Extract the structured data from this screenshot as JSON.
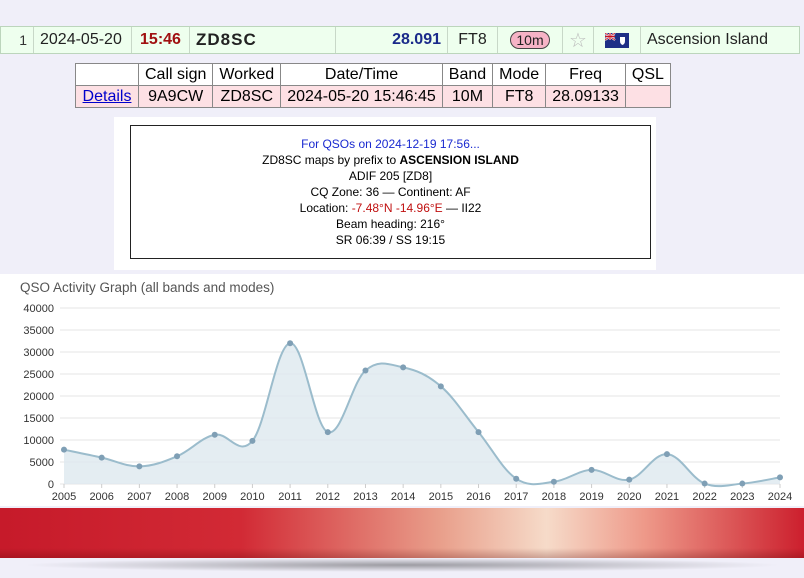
{
  "row": {
    "index": "1",
    "date": "2024-05-20",
    "time": "15:46",
    "callsign": "ZD8SC",
    "freq": "28.091",
    "mode": "FT8",
    "band": "10m",
    "star_icon": "star-icon",
    "flag_icon": "flag-ascension-island-icon",
    "country": "Ascension Island"
  },
  "qso_table": {
    "headers": [
      "",
      "Call sign",
      "Worked",
      "Date/Time",
      "Band",
      "Mode",
      "Freq",
      "QSL"
    ],
    "row": {
      "details": "Details",
      "callsign": "9A9CW",
      "worked": "ZD8SC",
      "datetime": "2024-05-20 15:46:45",
      "band": "10M",
      "mode": "FT8",
      "freq": "28.09133",
      "qsl": ""
    }
  },
  "info": {
    "line1": "For QSOs on 2024-12-19 17:56...",
    "line2a": "ZD8SC maps by prefix to ",
    "line2b": "ASCENSION ISLAND",
    "line3": "ADIF 205 [ZD8]",
    "line4": "CQ Zone: 36 — Continent: AF",
    "line5a": "Location: ",
    "line5b": "-7.48°N -14.96°E",
    "line5c": " — II22",
    "line6": "Beam heading: 216°",
    "line7": "SR 06:39 / SS 19:15"
  },
  "chart_data": {
    "type": "area",
    "title": "QSO Activity Graph (all bands and modes)",
    "x": [
      "2005",
      "2006",
      "2007",
      "2008",
      "2009",
      "2010",
      "2011",
      "2012",
      "2013",
      "2014",
      "2015",
      "2016",
      "2017",
      "2018",
      "2019",
      "2020",
      "2021",
      "2022",
      "2023",
      "2024"
    ],
    "values": [
      7800,
      6000,
      4000,
      6300,
      11200,
      9800,
      32000,
      11800,
      25800,
      26500,
      22200,
      11800,
      1200,
      500,
      3200,
      1000,
      6800,
      100,
      100,
      1500
    ],
    "yticks": [
      0,
      5000,
      10000,
      15000,
      20000,
      25000,
      30000,
      35000,
      40000
    ],
    "ylim": [
      0,
      40000
    ],
    "grid": true,
    "colors": {
      "line": "#9bbccc",
      "fill": "#dde9ef",
      "point": "#7f9fb5",
      "grid": "#e6e6e6",
      "text": "#333333"
    }
  }
}
